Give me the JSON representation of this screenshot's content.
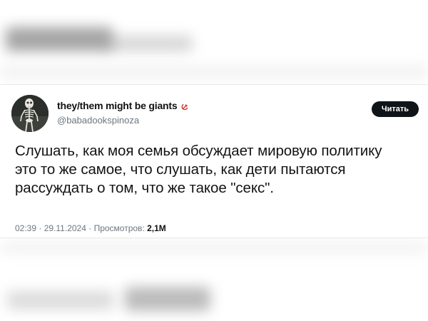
{
  "tweet": {
    "display_name": "they/them might be giants",
    "name_icon": "hammer-and-sickle",
    "handle": "@babadookspinoza",
    "follow_label": "Читать",
    "text_lines": [
      "Слушать, как моя семья обсуждает мировую политику",
      "это то же самое, что слушать, как дети пытаются",
      "рассуждать о том, что же такое \"секс\"."
    ],
    "time": "02:39",
    "date": "29.11.2024",
    "views_label": "Просмотров:",
    "views_count": "2,1M",
    "separator": "·"
  },
  "colors": {
    "button_bg": "#0f1419",
    "secondary_text": "#6b7680",
    "avatar_bg": "#2b2f2b"
  }
}
